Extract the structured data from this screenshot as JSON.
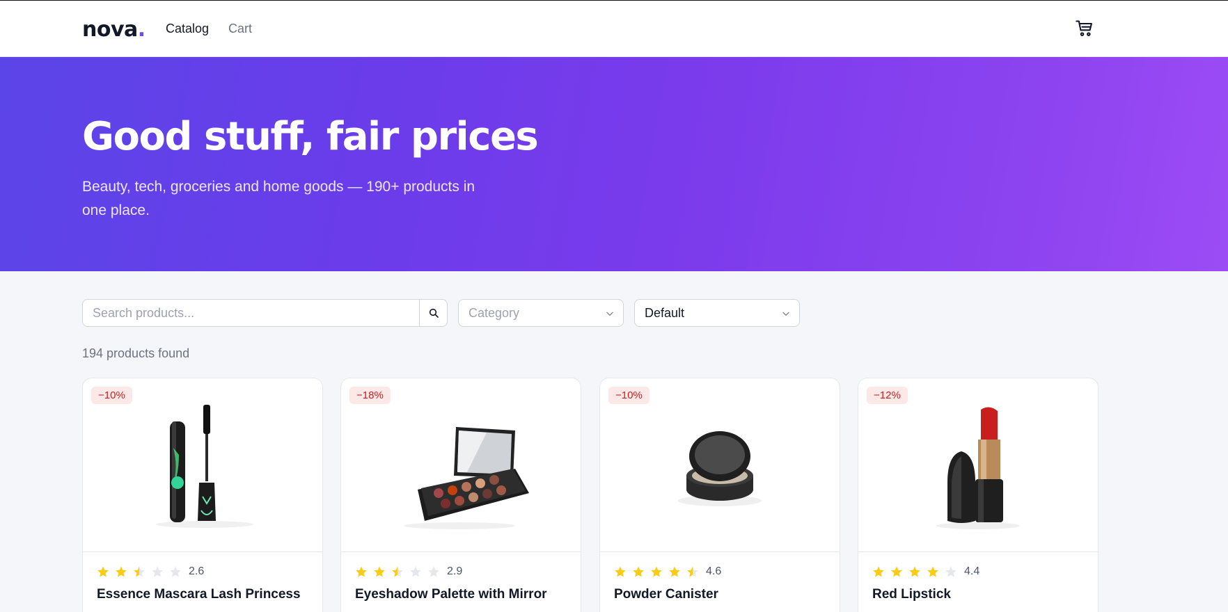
{
  "header": {
    "logo": "nova",
    "logo_dot": ".",
    "nav": {
      "catalog": "Catalog",
      "cart": "Cart"
    },
    "cart_icon": "cart-icon"
  },
  "hero": {
    "title": "Good stuff, fair prices",
    "subtitle": "Beauty, tech, groceries and home goods — 190+ products in one place."
  },
  "filters": {
    "search_placeholder": "Search products...",
    "search_value": "",
    "search_icon": "search-icon",
    "category_placeholder": "Category",
    "sort_value": "Default"
  },
  "results": {
    "count_text": "194 products found"
  },
  "products": [
    {
      "name": "Essence Mascara Lash Princess",
      "discount": "−10%",
      "rating": "2.6",
      "image_icon": "mascara-image"
    },
    {
      "name": "Eyeshadow Palette with Mirror",
      "discount": "−18%",
      "rating": "2.9",
      "image_icon": "eyeshadow-palette-image"
    },
    {
      "name": "Powder Canister",
      "discount": "−10%",
      "rating": "4.6",
      "image_icon": "powder-compact-image"
    },
    {
      "name": "Red Lipstick",
      "discount": "−12%",
      "rating": "4.4",
      "image_icon": "lipstick-image"
    }
  ],
  "colors": {
    "accent": "#6d4aff",
    "star": "#facc15",
    "star_empty": "#e5e7eb",
    "badge_bg": "#fde8e8",
    "badge_text": "#c81e1e"
  }
}
